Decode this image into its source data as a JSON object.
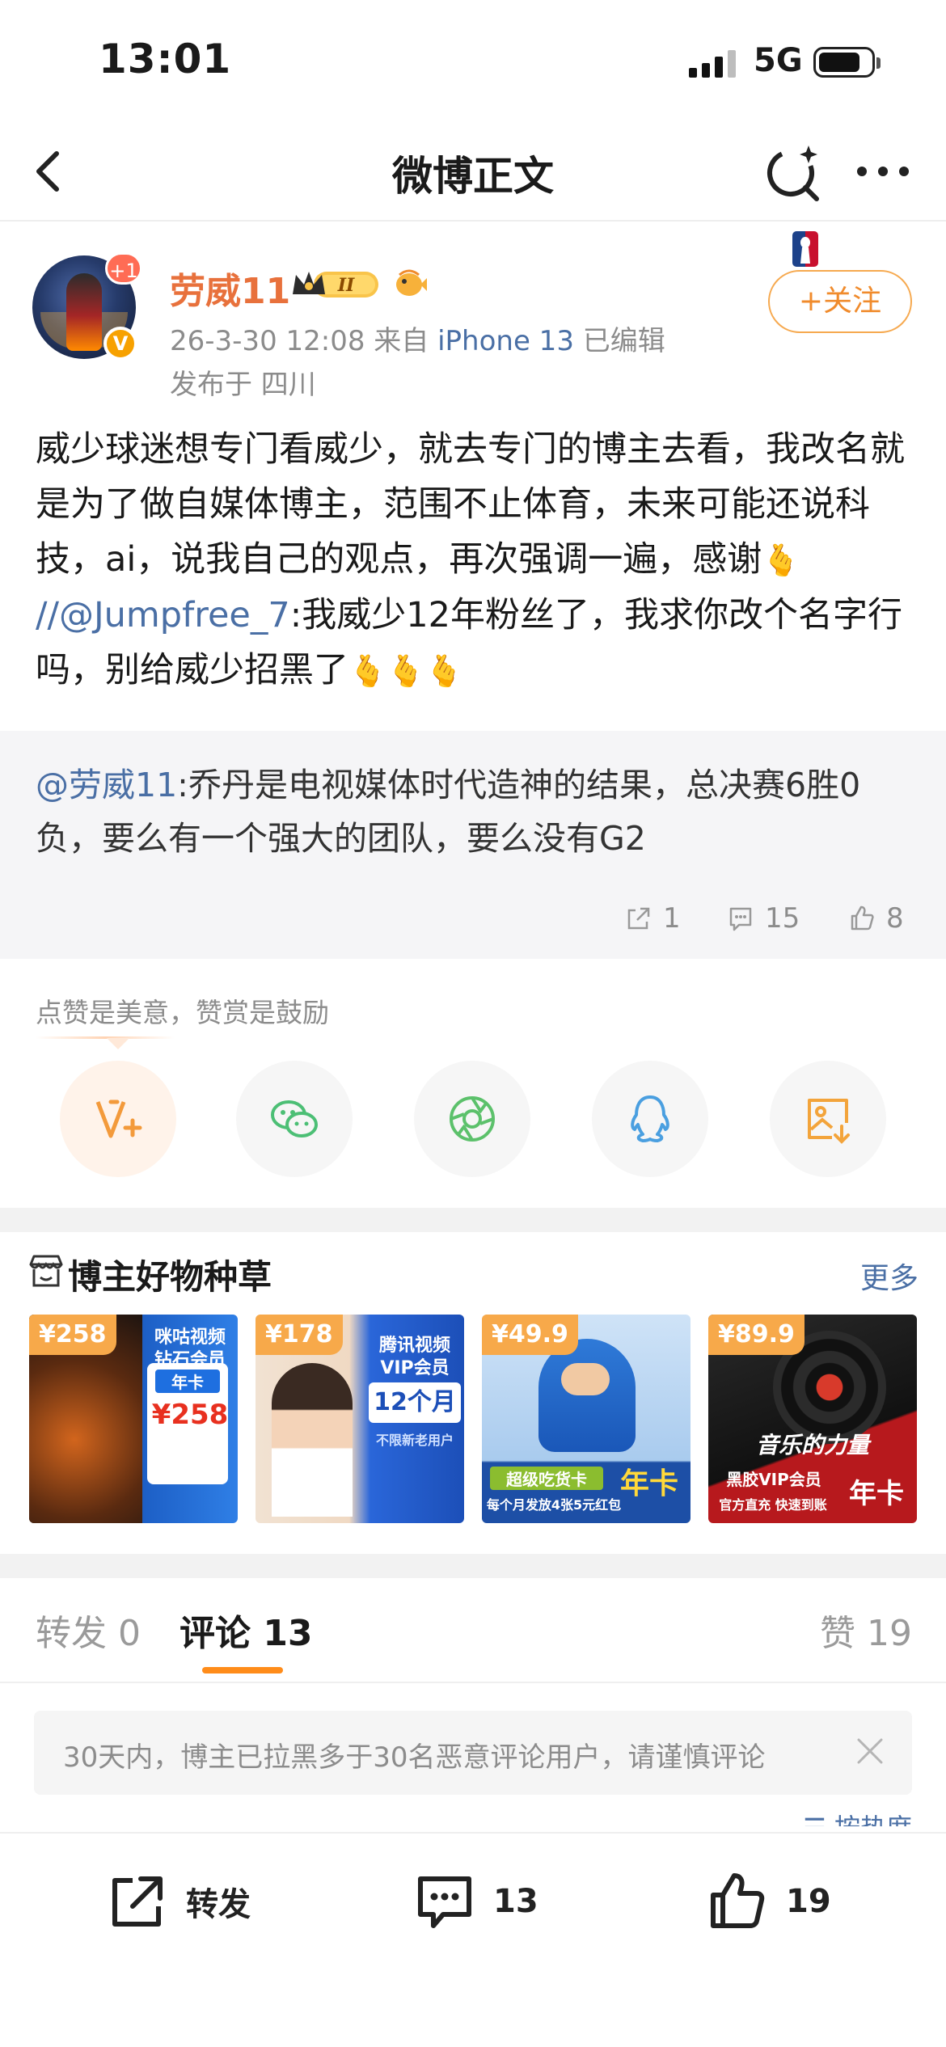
{
  "status_bar": {
    "time": "13:01",
    "network": "5G"
  },
  "nav": {
    "title": "微博正文",
    "icons": [
      "back-icon",
      "refresh-search-icon",
      "more-icon"
    ]
  },
  "post": {
    "author": "劳威11",
    "avatar_badge": "+1",
    "verified_mark": "V",
    "meta_prefix": "26-3-30 12:08  来自",
    "device": "iPhone 13",
    "edited": "已编辑",
    "location": "发布于 四川",
    "follow_label": "+关注",
    "text_part1": "威少球迷想专门看威少，就去专门的博主去看，我改名就是为了做自媒体博主，范围不止体育，未来可能还说科技，ai，说我自己的观点，再次强调一遍，感谢",
    "text_sep": "//",
    "text_mention": "@Jumpfree_7",
    "text_part2": ":我威少12年粉丝了，我求你改个名字行吗，别给威少招黑了",
    "emoji": "🫰"
  },
  "repost": {
    "mention": "@劳威11",
    "text": ":乔丹是电视媒体时代造神的结果，总决赛6胜0负，要么有一个强大的团队，要么没有G2",
    "shares": "1",
    "comments": "15",
    "likes": "8"
  },
  "reward": {
    "hint": "点赞是美意，赞赏是鼓励",
    "targets": [
      "reward-icon",
      "wechat-icon",
      "moments-icon",
      "qq-icon",
      "save-image-icon"
    ]
  },
  "products": {
    "title": "博主好物种草",
    "more": "更多",
    "items": [
      {
        "price": "¥258",
        "line1": "咪咕视频",
        "line2": "钻石会员",
        "line3": "年卡",
        "line4": "¥258"
      },
      {
        "price": "¥178",
        "line1": "腾讯视频",
        "line2": "VIP会员",
        "line3": "12个月",
        "line4": "不限新老用户"
      },
      {
        "price": "¥49.9",
        "line1": "超级吃货卡",
        "line2": "年卡",
        "line3": "每个月发放4张5元红包"
      },
      {
        "price": "¥89.9",
        "line1": "音乐的力量",
        "line2": "黑胶VIP会员",
        "line3": "年卡",
        "line4": "官方直充 快速到账"
      }
    ]
  },
  "tabs": {
    "repost": "转发 0",
    "comment": "评论 13",
    "likes": "赞 19"
  },
  "notice": {
    "text": "30天内，博主已拉黑多于30名恶意评论用户，请谨慎评论"
  },
  "bottom": {
    "repost": "转发",
    "comments": "13",
    "likes": "19"
  }
}
